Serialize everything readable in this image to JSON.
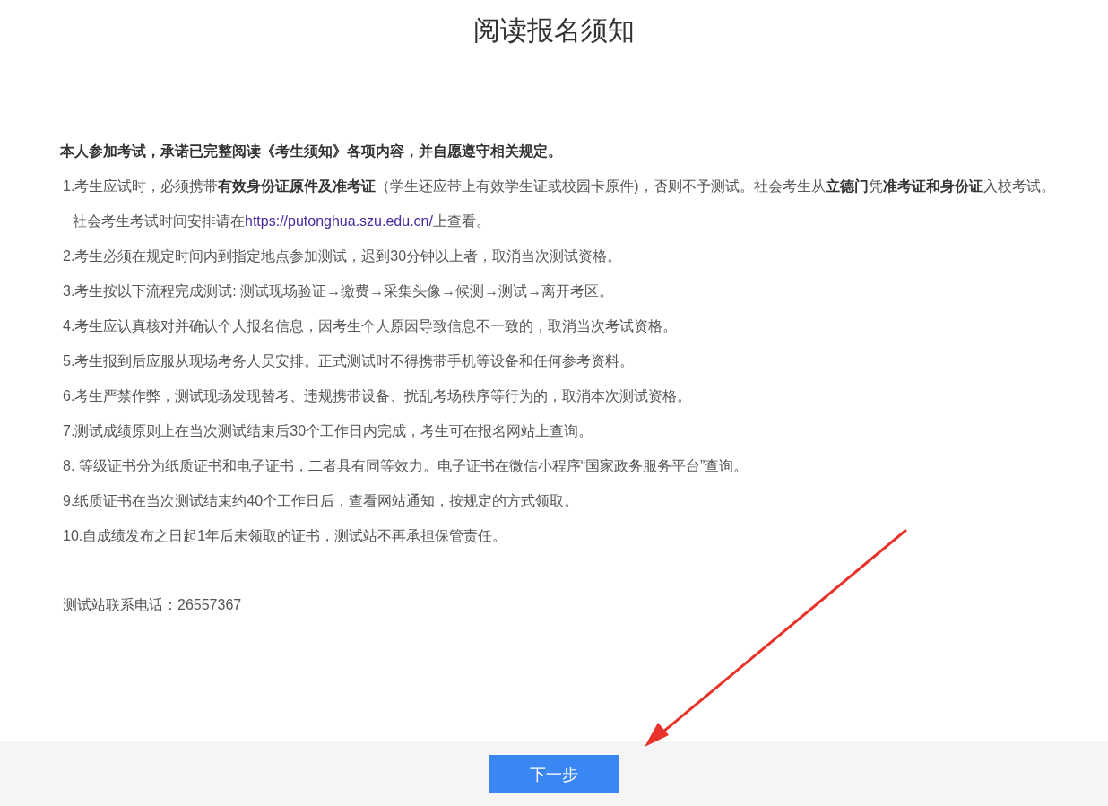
{
  "title": "阅读报名须知",
  "notice": {
    "paragraphs": [
      {
        "kind": "lead",
        "text": "本人参加考试，承诺已完整阅读《考生须知》各项内容，并自愿遵守相关规定。"
      },
      {
        "kind": "text",
        "text": "1.考生应试时，必须携带**有效身份证原件及准考证**（学生还应带上有效学生证或校园卡原件)，否则不予测试。社会考生从**立德门**凭**准考证和身份证**入校考试。"
      },
      {
        "kind": "link",
        "before": "社会考生考试时间安排请在",
        "link": "https://putonghua.szu.edu.cn/",
        "after": "上查看。"
      },
      {
        "kind": "text",
        "text": "2.考生必须在规定时间内到指定地点参加测试，迟到30分钟以上者，取消当次测试资格。"
      },
      {
        "kind": "text",
        "text": "3.考生按以下流程完成测试: 测试现场验证→缴费→采集头像→候测→测试→离开考区。"
      },
      {
        "kind": "text",
        "text": "4.考生应认真核对并确认个人报名信息，因考生个人原因导致信息不一致的，取消当次考试资格。"
      },
      {
        "kind": "text",
        "text": "5.考生报到后应服从现场考务人员安排。正式测试时不得携带手机等设备和任何参考资料。"
      },
      {
        "kind": "text",
        "text": "6.考生严禁作弊，测试现场发现替考、违规携带设备、扰乱考场秩序等行为的，取消本次测试资格。"
      },
      {
        "kind": "text",
        "text": "7.测试成绩原则上在当次测试结束后30个工作日内完成，考生可在报名网站上查询。"
      },
      {
        "kind": "text",
        "text": "8. 等级证书分为纸质证书和电子证书，二者具有同等效力。电子证书在微信小程序“国家政务服务平台”查询。"
      },
      {
        "kind": "text",
        "text": "9.纸质证书在当次测试结束约40个工作日后，查看网站通知，按规定的方式领取。"
      },
      {
        "kind": "text",
        "text": "10.自成绩发布之日起1年后未领取的证书，测试站不再承担保管责任。"
      }
    ],
    "contact": "测试站联系电话：26557367"
  },
  "footer": {
    "button": "下一步"
  }
}
